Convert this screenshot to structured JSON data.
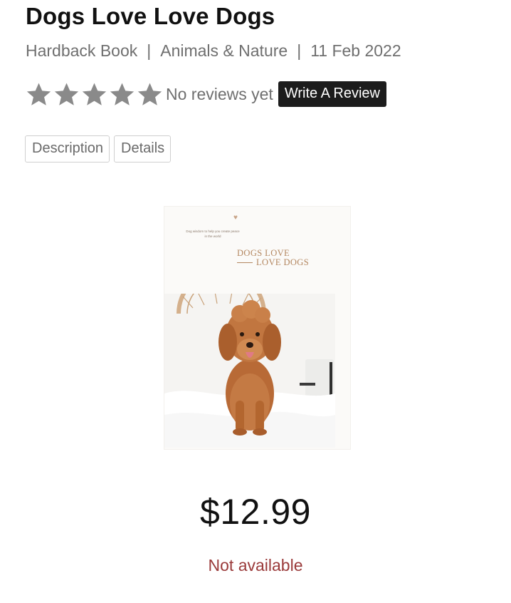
{
  "product": {
    "title": "Dogs Love Love Dogs",
    "format": "Hardback Book",
    "category": "Animals & Nature",
    "release_date": "11 Feb 2022",
    "separator": "|",
    "rating": {
      "stars": 0,
      "max_stars": 5,
      "icon": "star-icon",
      "star_color": "#8a8a8a"
    },
    "reviews_text": "No reviews yet",
    "write_review_label": "Write A Review",
    "tabs": [
      {
        "label": "Description"
      },
      {
        "label": "Details"
      }
    ],
    "cover": {
      "tagline": "Dog wisdom to help you create peace in the world",
      "title_line1": "DOGS LOVE",
      "title_line2": "LOVE DOGS",
      "title_color": "#b3865f"
    },
    "price": "$12.99",
    "availability": "Not available",
    "availability_color": "#9a3a3a"
  }
}
